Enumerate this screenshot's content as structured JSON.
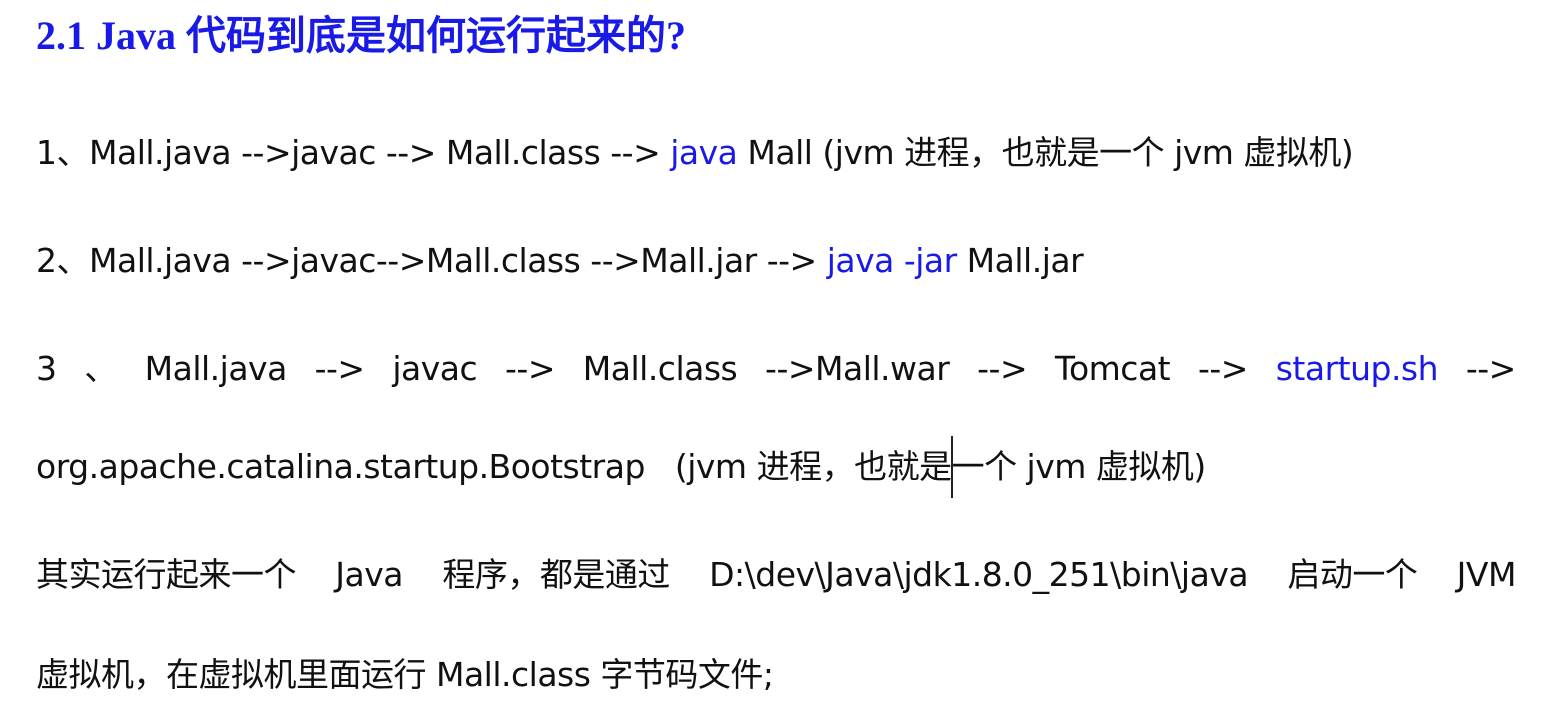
{
  "heading": "2.1  Java 代码到底是如何运行起来的?",
  "line1": {
    "prefix": "1、Mall.java -->javac --> Mall.class --> ",
    "highlight": "java",
    "suffix": " Mall (jvm 进程，也就是一个 jvm 虚拟机)"
  },
  "line2": {
    "prefix": "2、Mall.java -->javac-->Mall.class -->Mall.jar --> ",
    "highlight": "java -jar",
    "suffix": " Mall.jar"
  },
  "line3": {
    "tokens": [
      "3",
      "、",
      "Mall.java",
      "-->",
      "javac",
      "-->",
      "Mall.class",
      "-->Mall.war",
      "-->",
      "Tomcat",
      "-->"
    ],
    "highlight": "startup.sh",
    "end": "-->"
  },
  "line4": "org.apache.catalina.startup.Bootstrap   (jvm 进程，也就是一个 jvm 虚拟机)",
  "line5": {
    "tokens": [
      "其实运行起来一个",
      "Java",
      "程序，都是通过",
      "D:\\dev\\Java\\jdk1.8.0_251\\bin\\java",
      "启动一个",
      "JVM"
    ]
  },
  "line6": "虚拟机，在虚拟机里面运行 Mall.class 字节码文件;",
  "colors": {
    "heading": "#1a1ae6",
    "highlight": "#1a1ae6",
    "text": "#111111",
    "background": "#ffffff"
  }
}
